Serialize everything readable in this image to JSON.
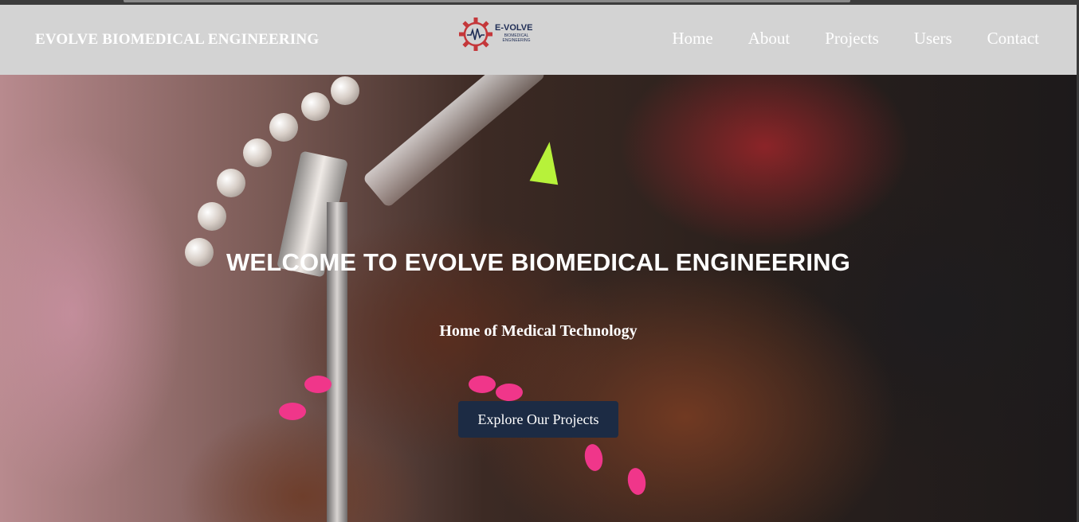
{
  "header": {
    "brand": "EVOLVE BIOMEDICAL ENGINEERING",
    "logo": {
      "name": "E-VOLVE",
      "tagline": "BIOMEDICAL ENGINEERING"
    },
    "nav": [
      "Home",
      "About",
      "Projects",
      "Users",
      "Contact"
    ]
  },
  "hero": {
    "title": "WELCOME TO EVOLVE BIOMEDICAL ENGINEERING",
    "subtitle": "Home of Medical Technology",
    "cta_label": "Explore Our Projects",
    "background_image": "person-soldering-electronics-photo"
  },
  "colors": {
    "navbar_bg": "#d3d3d3",
    "cta_bg": "#1c2b44",
    "logo_text": "#1f2d55",
    "logo_gear": "#c4373a"
  }
}
